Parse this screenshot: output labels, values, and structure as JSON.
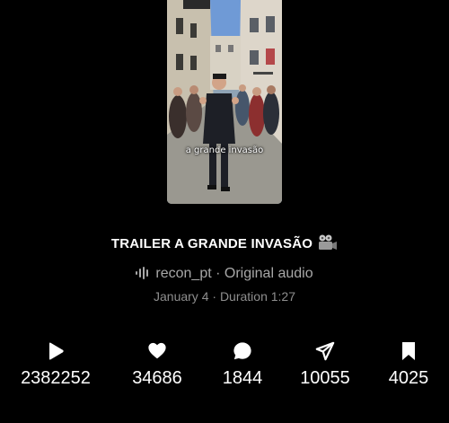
{
  "reel": {
    "caption": "a grande invasão",
    "title": "TRAILER A GRANDE INVASÃO",
    "title_icon": "movie-camera-icon",
    "audio": {
      "icon": "audio-wave-icon",
      "username": "recon_pt",
      "separator": " · ",
      "label": "Original audio"
    },
    "meta": {
      "date": "January 4",
      "separator": " · ",
      "duration": "Duration 1:27"
    }
  },
  "stats": [
    {
      "icon": "play-icon",
      "value": "2382252"
    },
    {
      "icon": "heart-icon",
      "value": "34686"
    },
    {
      "icon": "comment-icon",
      "value": "1844"
    },
    {
      "icon": "share-icon",
      "value": "10055"
    },
    {
      "icon": "bookmark-icon",
      "value": "4025"
    }
  ],
  "colors": {
    "background": "#000000",
    "primary_text": "#ffffff",
    "secondary_text": "#a8a8a8",
    "muted_text": "#8e8e8e"
  }
}
